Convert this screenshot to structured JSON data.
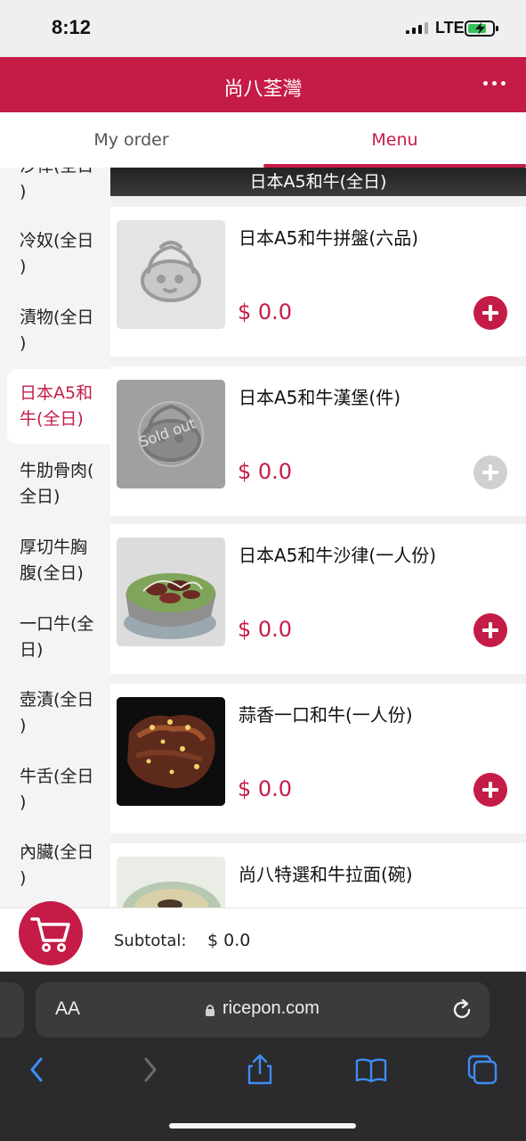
{
  "status_bar": {
    "time": "8:12",
    "network": "LTE"
  },
  "header": {
    "title": "尚八荃灣"
  },
  "tabs": [
    {
      "label": "My order"
    },
    {
      "label": "Menu"
    }
  ],
  "categories": [
    {
      "line1": "沙律(全日",
      "line2": ")"
    },
    {
      "line1": "冷奴(全日",
      "line2": ")"
    },
    {
      "line1": "漬物(全日",
      "line2": ")"
    },
    {
      "line1": "日本A5和",
      "line2": "牛(全日)"
    },
    {
      "line1": "牛肋骨肉(",
      "line2": "全日)"
    },
    {
      "line1": "厚切牛胸",
      "line2": "腹(全日)"
    },
    {
      "line1": "一口牛(全",
      "line2": "日)"
    },
    {
      "line1": "壺漬(全日",
      "line2": ")"
    },
    {
      "line1": "牛舌(全日",
      "line2": ")"
    },
    {
      "line1": "內臟(全日",
      "line2": ")"
    }
  ],
  "section": {
    "title": "日本A5和牛(全日)"
  },
  "items": [
    {
      "name": "日本A5和牛拼盤(六品)",
      "price": "$ 0.0",
      "image": "placeholder-mascot"
    },
    {
      "name": "日本A5和牛漢堡(件)",
      "price": "$ 0.0",
      "image": "placeholder-mascot",
      "sold_out": "Sold out"
    },
    {
      "name": "日本A5和牛沙律(一人份)",
      "price": "$ 0.0",
      "image": "beef-salad-photo"
    },
    {
      "name": "蒜香一口和牛(一人份)",
      "price": "$ 0.0",
      "image": "garlic-beef-photo"
    },
    {
      "name": "尚八特選和牛拉面(碗)",
      "image": "ramen-photo"
    }
  ],
  "footer": {
    "subtotal_label": "Subtotal:",
    "subtotal_value": "$ 0.0"
  },
  "browser": {
    "aa_label": "AA",
    "url": "ricepon.com"
  },
  "colors": {
    "brand": "#c51c47",
    "disabled": "#d0d0d0"
  }
}
